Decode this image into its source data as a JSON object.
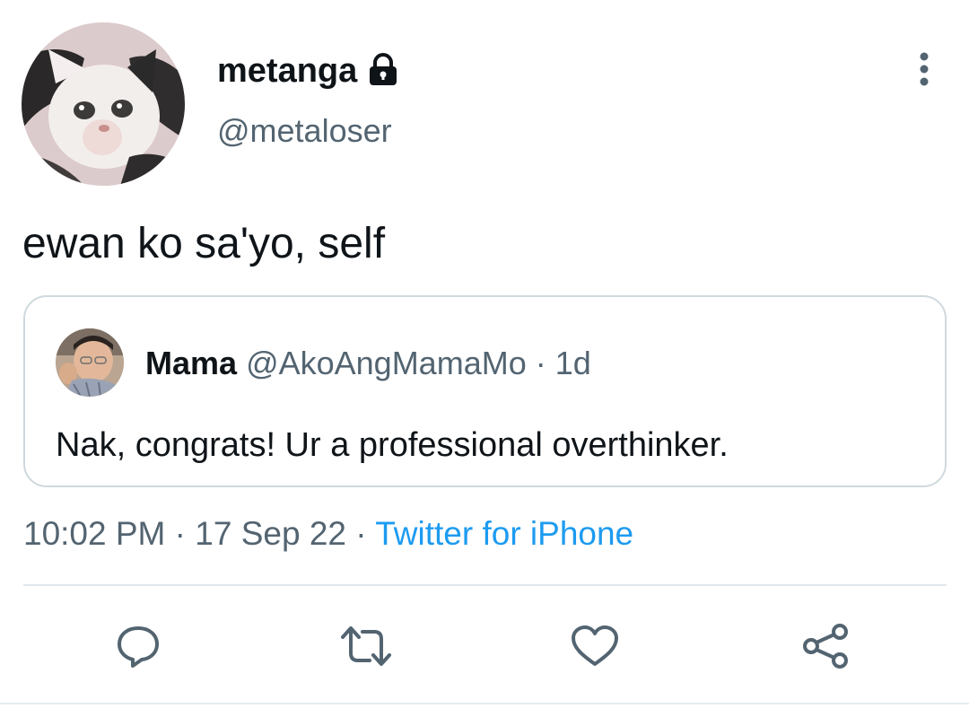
{
  "author": {
    "display_name": "metanga",
    "handle": "@metaloser",
    "protected": true
  },
  "icons": {
    "lock": "lock-icon",
    "more": "more-options-icon",
    "reply": "reply-icon",
    "retweet": "retweet-icon",
    "like": "heart-icon",
    "share": "share-icon"
  },
  "tweet": {
    "text": "ewan ko sa'yo, self"
  },
  "quoted_tweet": {
    "display_name": "Mama",
    "handle": "@AkoAngMamaMo",
    "separator": "·",
    "time": "1d",
    "text": "Nak, congrats! Ur a professional overthinker."
  },
  "meta": {
    "time": "10:02 PM",
    "separator": "·",
    "date": "17 Sep 22",
    "source": "Twitter for iPhone"
  },
  "colors": {
    "text_primary": "#0f1419",
    "text_secondary": "#536471",
    "link": "#1d9bf0",
    "border": "#cfd9de",
    "icon": "#536471"
  }
}
